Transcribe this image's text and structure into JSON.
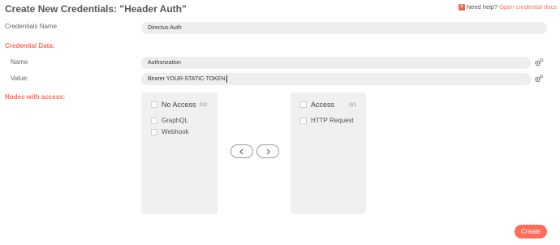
{
  "header": {
    "title": "Create New Credentials: \"Header Auth\"",
    "help_text": "Need help?",
    "help_link": "Open credential docs",
    "help_icon": "question-icon"
  },
  "credentials_name": {
    "label": "Credentials Name",
    "value": "Directus Auth"
  },
  "credential_data": {
    "section_label": "Credential Data:",
    "name_label": "Name",
    "name_value": "Authorization",
    "value_label": "Value:",
    "value_value": "Bearer YOUR-STATIC-TOKEN",
    "options_icon": "gears-icon"
  },
  "nodes_access": {
    "section_label": "Nodes with access:",
    "no_access": {
      "title": "No Access",
      "count": "0/2",
      "items": [
        "GraphQL",
        "Webhook"
      ]
    },
    "access": {
      "title": "Access",
      "count": "0/1",
      "items": [
        "HTTP Request"
      ]
    },
    "move_left_icon": "chevron-left-icon",
    "move_right_icon": "chevron-right-icon"
  },
  "footer": {
    "create_label": "Create"
  },
  "colors": {
    "accent": "#ff6d5a",
    "field_bg": "#eeeeee",
    "panel_bg": "#f0f0f0"
  }
}
